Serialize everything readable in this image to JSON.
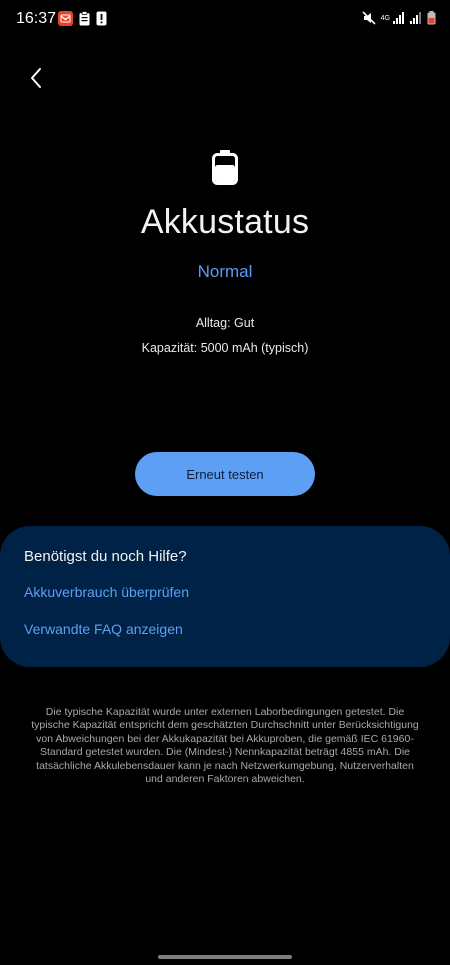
{
  "status_bar": {
    "time": "16:37",
    "network_label": "4G",
    "notification_icons": [
      "mail-app-icon",
      "clipboard-icon",
      "alert-icon"
    ],
    "system_icons": [
      "mute-icon",
      "signal-icon",
      "signal-icon",
      "battery-icon"
    ]
  },
  "header": {
    "back_icon": "chevron-left-icon"
  },
  "hero": {
    "icon": "battery-icon",
    "title": "Akkustatus",
    "status": "Normal",
    "everyday": "Alltag: Gut",
    "capacity": "Kapazität: 5000 mAh (typisch)"
  },
  "actions": {
    "retest_label": "Erneut testen"
  },
  "help": {
    "title": "Benötigst du noch Hilfe?",
    "links": [
      "Akkuverbrauch überprüfen",
      "Verwandte FAQ anzeigen"
    ]
  },
  "disclaimer": "Die typische Kapazität wurde unter externen Laborbedingungen getestet. Die typische Kapazität entspricht dem geschätzten Durchschnitt unter Berücksichtigung von Abweichungen bei der Akkukapazität bei Akkuproben, die gemäß IEC 61960-Standard getestet wurden. Die (Mindest-) Nennkapazität beträgt 4855 mAh. Die tatsächliche Akkulebensdauer kann je nach Netzwerkumgebung, Nutzerverhalten und anderen Faktoren abweichen.",
  "colors": {
    "background": "#000000",
    "accent": "#5e9ff6",
    "card": "#002246",
    "notification_badge": "#e8412c"
  }
}
